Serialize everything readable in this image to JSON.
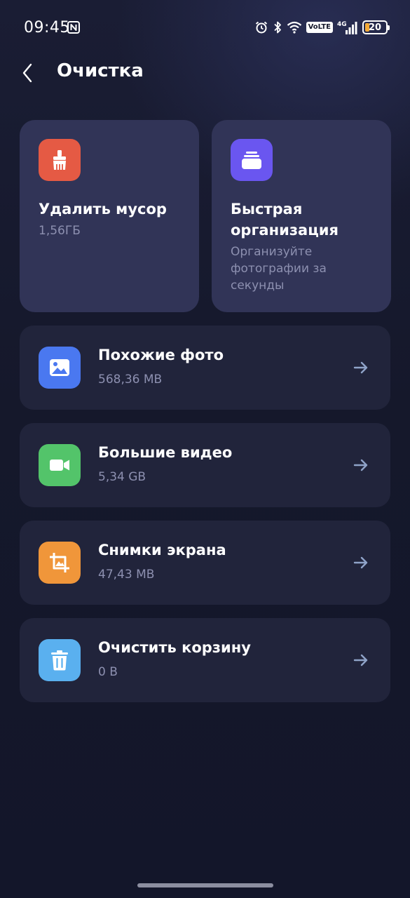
{
  "status_bar": {
    "time": "09:45",
    "network": "4G",
    "volte": "VoLTE",
    "battery_percent": "20",
    "battery_level": 0.2,
    "icons": [
      "nfc-icon",
      "alarm-icon",
      "bluetooth-icon",
      "wifi-icon",
      "volte-icon",
      "signal-icon",
      "battery-icon"
    ]
  },
  "header": {
    "title": "Очистка",
    "back_icon": "chevron-left-icon"
  },
  "tiles": [
    {
      "title": "Удалить мусор",
      "subtitle": "1,56ГБ",
      "icon": "broom-icon",
      "icon_color": "#e55a44"
    },
    {
      "title": "Быстрая организация",
      "subtitle": "Организуйте фотографии за секунды",
      "icon": "stack-icon",
      "icon_color": "#6a56f0"
    }
  ],
  "items": [
    {
      "title": "Похожие фото",
      "subtitle": "568,36 MB",
      "icon": "image-icon",
      "icon_color": "#4a78f0"
    },
    {
      "title": "Большие видео",
      "subtitle": "5,34 GB",
      "icon": "video-camera-icon",
      "icon_color": "#53c46a"
    },
    {
      "title": "Снимки экрана",
      "subtitle": "47,43 MB",
      "icon": "crop-screenshot-icon",
      "icon_color": "#f0963a"
    },
    {
      "title": "Очистить корзину",
      "subtitle": "0 B",
      "icon": "trash-icon",
      "icon_color": "#5ab0ef"
    }
  ],
  "colors": {
    "background": "#14172a",
    "tile_background": "#313457",
    "row_background": "#21243b",
    "secondary_text": "#8d90b0",
    "arrow": "#8fa3c8"
  }
}
